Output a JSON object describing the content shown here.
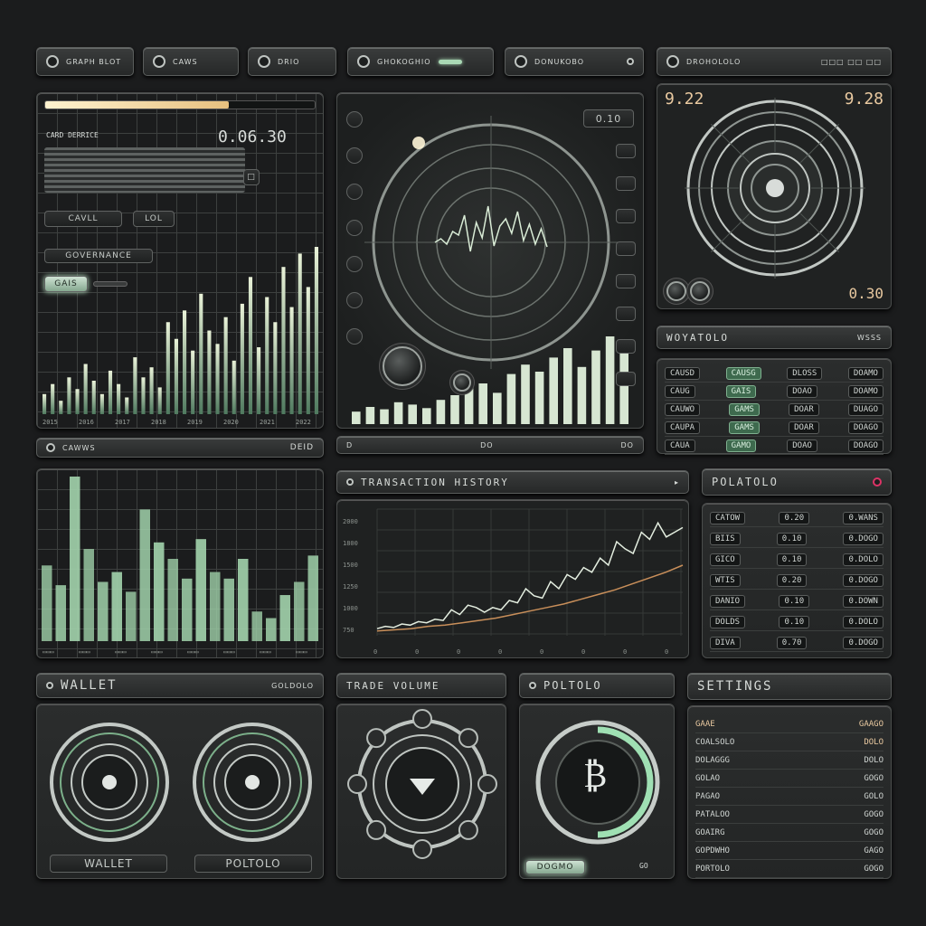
{
  "top_tabs": [
    {
      "label": "GRAPH BLOT",
      "icon": "cross-icon"
    },
    {
      "label": "CAWS",
      "icon": "shield-icon"
    },
    {
      "label": "DRIO",
      "icon": "clock-icon"
    },
    {
      "label": "GHOKOGHIO",
      "icon": "eye-icon"
    },
    {
      "label": "DONUKOBO",
      "icon": "eye-icon"
    },
    {
      "label": "DROHOLOLO",
      "icon": "link-icon"
    }
  ],
  "left_chart": {
    "readout": "0.06.30",
    "caption": "CARD DERRICE",
    "btn_a": "CAVLL",
    "btn_b": "LOL",
    "btn_c": "GOVERNANCE",
    "btn_d": "GAIS",
    "values": [
      12,
      18,
      8,
      22,
      15,
      30,
      20,
      12,
      26,
      18,
      10,
      34,
      22,
      28,
      16,
      55,
      45,
      62,
      38,
      72,
      50,
      42,
      58,
      32,
      66,
      82,
      40,
      70,
      55,
      88,
      64,
      96,
      76,
      100
    ],
    "x_ticks": [
      "2015",
      "2016",
      "2017",
      "2018",
      "2019",
      "2020",
      "2021",
      "2022"
    ]
  },
  "radar": {
    "readout": "0.10",
    "left_buttons": 7,
    "right_buttons": 8,
    "base_bars": [
      6,
      10,
      8,
      14,
      12,
      9,
      16,
      20,
      26,
      30,
      22,
      38,
      46,
      40,
      52,
      60,
      44,
      58,
      70,
      64
    ],
    "trace": [
      40,
      44,
      38,
      52,
      48,
      70,
      30,
      62,
      45,
      80,
      36,
      58,
      66,
      50,
      74,
      42,
      60,
      38,
      55,
      35
    ]
  },
  "speaker": {
    "reading_left": "9.22",
    "reading_right": "9.28",
    "reading_bottom": "0.30"
  },
  "left_status": {
    "label": "CAWWS",
    "value": "DEID"
  },
  "bottom_bars": {
    "values": [
      46,
      34,
      100,
      56,
      36,
      42,
      30,
      80,
      60,
      50,
      38,
      62,
      42,
      38,
      50,
      18,
      14,
      28,
      36,
      52
    ]
  },
  "radar_status": [
    {
      "label": "D"
    },
    {
      "label": "DO"
    },
    {
      "label": "DO"
    }
  ],
  "portfolio_right": {
    "title": "WOYATOLO",
    "side": "WSSS",
    "rows": [
      {
        "a": "CAUSD",
        "b": "CAUSG",
        "c": "DLOSS",
        "d": "DOAMO"
      },
      {
        "a": "CAUG",
        "b": "GAIS",
        "c": "DOAO",
        "d": "DOAMO"
      },
      {
        "a": "CAUWO",
        "b": "GAMS",
        "c": "DOAR",
        "d": "DUAGO"
      },
      {
        "a": "CAUPA",
        "b": "GAMS",
        "c": "DOAR",
        "d": "DOAGO"
      },
      {
        "a": "CAUA",
        "b": "GAMO",
        "c": "DOAO",
        "d": "DOAGO"
      }
    ]
  },
  "transactions": {
    "title": "TRANSACTION HISTORY",
    "y_ticks": [
      "2000",
      "1800",
      "1500",
      "1250",
      "1000",
      "750"
    ],
    "x_ticks": [
      "0",
      "0",
      "0",
      "0",
      "0",
      "0",
      "0",
      "0"
    ],
    "price": [
      6,
      8,
      7,
      10,
      9,
      12,
      11,
      14,
      13,
      22,
      18,
      26,
      24,
      20,
      24,
      22,
      30,
      28,
      40,
      34,
      32,
      46,
      40,
      52,
      48,
      58,
      54,
      66,
      60,
      80,
      74,
      70,
      88,
      82,
      96,
      84,
      88,
      92
    ],
    "trend": [
      4,
      5,
      6,
      8,
      9,
      11,
      13,
      15,
      18,
      21,
      24,
      27,
      31,
      35,
      39,
      44,
      49,
      54,
      60
    ]
  },
  "portfolio_table": {
    "title": "POLATOLO",
    "rows": [
      {
        "a": "CATOW",
        "b": "0.20",
        "c": "0.WANS"
      },
      {
        "a": "BIIS",
        "b": "0.10",
        "c": "0.DOGO"
      },
      {
        "a": "GICO",
        "b": "0.10",
        "c": "0.DOLO"
      },
      {
        "a": "WTIS",
        "b": "0.20",
        "c": "0.DOGO"
      },
      {
        "a": "DANIO",
        "b": "0.10",
        "c": "0.DOWN"
      },
      {
        "a": "DOLDS",
        "b": "0.10",
        "c": "0.DOLO"
      },
      {
        "a": "DIVA",
        "b": "0.70",
        "c": "0.DOGO"
      }
    ]
  },
  "wallet": {
    "title": "WALLET",
    "side": "GOLDOLO",
    "btn_left": "WALLET",
    "btn_right": "POLTOLO"
  },
  "trade_volume": {
    "title": "TRADE VOLUME"
  },
  "portfolio_coin": {
    "title": "POLTOLO",
    "symbol": "₿",
    "btn": "DOGMO",
    "side": "GO"
  },
  "settings": {
    "title": "SETTINGS",
    "rows": [
      {
        "a": "GAAE",
        "b": "GAAGO"
      },
      {
        "a": "COALSOLO",
        "b": "DOLO"
      },
      {
        "a": "DOLAGGG",
        "b": "DOLO"
      },
      {
        "a": "GOLAO",
        "b": "GOGO"
      },
      {
        "a": "PAGAO",
        "b": "GOLO"
      },
      {
        "a": "PATALOO",
        "b": "GOGO"
      },
      {
        "a": "GOAIRG",
        "b": "GOGO"
      },
      {
        "a": "GOPDWHO",
        "b": "GAGO"
      },
      {
        "a": "PORTOLO",
        "b": "GOGO"
      }
    ]
  }
}
